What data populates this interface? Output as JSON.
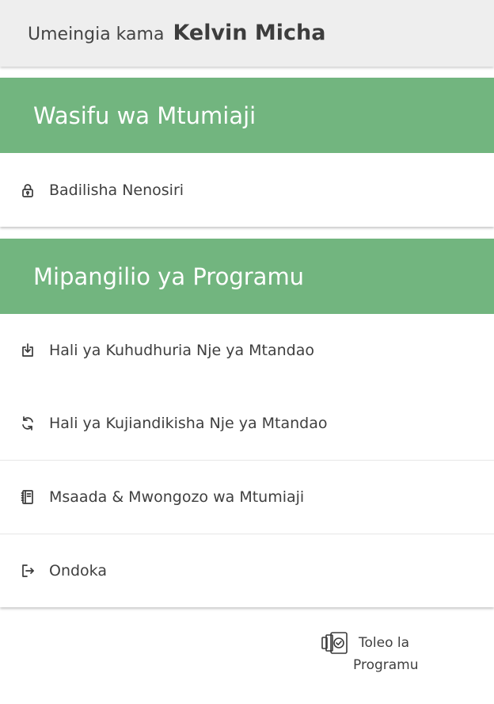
{
  "header": {
    "prefix": "Umeingia kama",
    "user_name": "Kelvin Micha"
  },
  "profile_section": {
    "title": "Wasifu wa Mtumiaji",
    "items": [
      {
        "label": "Badilisha Nenosiri",
        "icon": "lock-icon"
      }
    ]
  },
  "settings_section": {
    "title": "Mipangilio ya Programu",
    "items": [
      {
        "label": "Hali ya Kuhudhuria Nje ya Mtandao",
        "icon": "download-tray-icon"
      },
      {
        "label": "Hali ya Kujiandikisha Nje ya Mtandao",
        "icon": "sync-icon"
      },
      {
        "label": "Msaada & Mwongozo wa Mtumiaji",
        "icon": "notebook-icon"
      },
      {
        "label": "Ondoka",
        "icon": "logout-icon"
      }
    ]
  },
  "version": {
    "line1": "Toleo la",
    "line2": "Programu",
    "icon": "app-version-icon"
  },
  "colors": {
    "section_header": "#72b57f",
    "top_bar": "#eeeeee"
  }
}
